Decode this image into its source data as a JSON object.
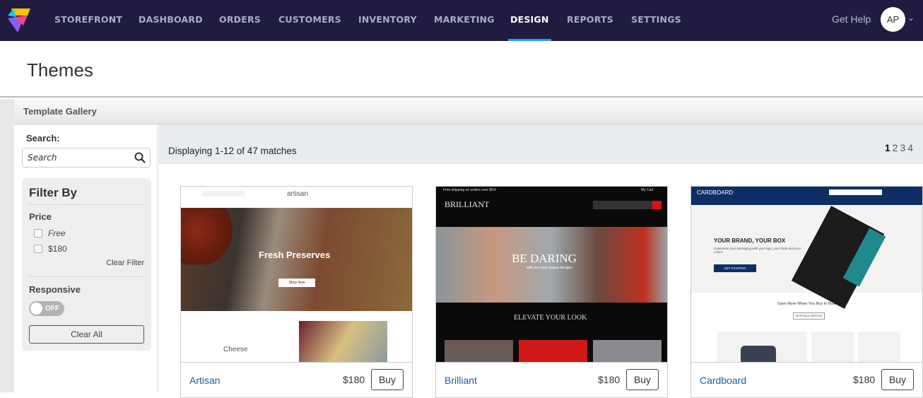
{
  "nav": {
    "items": [
      {
        "label": "STOREFRONT"
      },
      {
        "label": "DASHBOARD"
      },
      {
        "label": "ORDERS"
      },
      {
        "label": "CUSTOMERS"
      },
      {
        "label": "INVENTORY"
      },
      {
        "label": "MARKETING"
      },
      {
        "label": "DESIGN",
        "active": true
      },
      {
        "label": "REPORTS"
      },
      {
        "label": "SETTINGS"
      }
    ],
    "help": "Get Help",
    "avatar": "AP",
    "colors": {
      "bg": "#201c3f",
      "active_underline": "#1aa3e8"
    }
  },
  "page": {
    "title": "Themes"
  },
  "gallery": {
    "title": "Template Gallery"
  },
  "sidebar": {
    "search_label": "Search:",
    "search_placeholder": "Search",
    "filter_title": "Filter By",
    "price_label": "Price",
    "price_options": [
      {
        "label": "Free",
        "checked": false
      },
      {
        "label": "$180",
        "checked": false
      }
    ],
    "clear_filter": "Clear Filter",
    "responsive_label": "Responsive",
    "responsive_toggle": "OFF",
    "clear_all": "Clear All"
  },
  "results": {
    "display": "Displaying 1-12 of 47 matches",
    "pages": [
      "1",
      "2",
      "3",
      "4"
    ],
    "current_page": "1"
  },
  "cards": [
    {
      "name": "Artisan",
      "price": "$180",
      "buy": "Buy",
      "thumb": {
        "brand": "artisan",
        "hero": "Fresh Preserves",
        "cta": "Shop Now",
        "section": "Cheese"
      }
    },
    {
      "name": "Brilliant",
      "price": "$180",
      "buy": "Buy",
      "thumb": {
        "topbar": "Free shipping on orders over $50!",
        "cart": "My Cart",
        "brand": "BRILLIANT",
        "hero": "BE DARING",
        "sub": "with our most unique designs",
        "section": "ELEVATE YOUR LOOK"
      }
    },
    {
      "name": "Cardboard",
      "price": "$180",
      "buy": "Buy",
      "thumb": {
        "brand": "CARDBOARD",
        "hero": "YOUR BRAND, YOUR BOX",
        "sub": "Customize your packaging with your logo, your fonts and your colors.",
        "cta": "GET STARTED",
        "section": "Save More When You Buy In Bulk",
        "cta2": "SHOP BULK SUPPLIES"
      }
    }
  ]
}
